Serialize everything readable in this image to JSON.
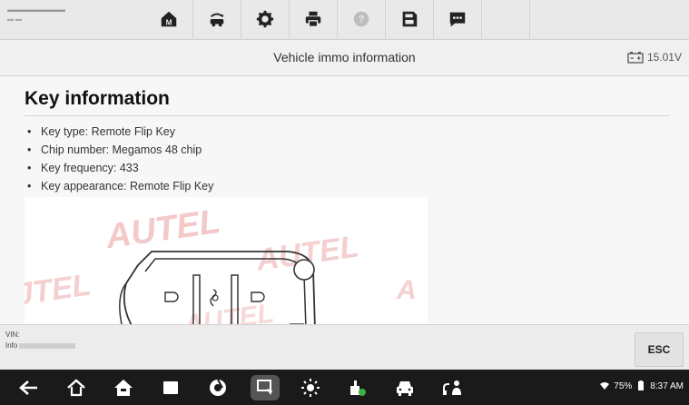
{
  "toolbar": {
    "buttons": [
      {
        "name": "home",
        "icon": "home-m-icon"
      },
      {
        "name": "vehicle-swap",
        "icon": "car-swap-icon"
      },
      {
        "name": "settings",
        "icon": "gear-icon"
      },
      {
        "name": "print",
        "icon": "printer-icon"
      },
      {
        "name": "help",
        "icon": "help-icon"
      },
      {
        "name": "save",
        "icon": "save-icon"
      },
      {
        "name": "feedback",
        "icon": "message-icon"
      }
    ]
  },
  "titlebar": {
    "title": "Vehicle immo information",
    "battery_voltage": "15.01V"
  },
  "content": {
    "heading": "Key information",
    "items": [
      "Key type: Remote Flip Key",
      "Chip number: Megamos 48 chip",
      "Key frequency: 433",
      "Key appearance: Remote Flip Key"
    ],
    "image": {
      "watermark": "AUTEL",
      "watermark_color": "#f3c9c9"
    }
  },
  "infobar": {
    "vin_label": "VIN:",
    "info_label": "Info",
    "esc_label": "ESC"
  },
  "navbar": {
    "icons": [
      "back-icon",
      "home-icon",
      "house-icon",
      "recent-apps-icon",
      "browser-icon",
      "screen-capture-icon",
      "brightness-icon",
      "vci-icon",
      "car-icon",
      "remote-support-icon"
    ],
    "battery_percent": "75%",
    "time": "8:37 AM"
  },
  "colors": {
    "toolbar_bg": "#e9e9e9",
    "navbar_bg": "#1a1a1a",
    "page_bg": "#f7f7f7"
  }
}
